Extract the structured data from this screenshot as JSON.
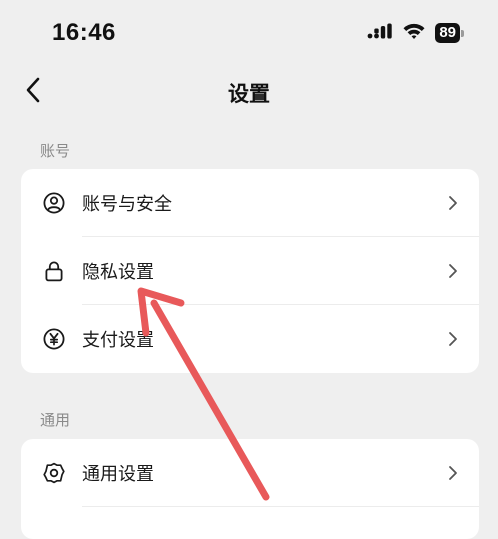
{
  "status_bar": {
    "time": "16:46",
    "battery_level": "89",
    "icons": [
      "cellular-signal-icon",
      "wifi-icon",
      "battery-icon"
    ]
  },
  "nav": {
    "title": "设置",
    "back_icon": "chevron-left-icon"
  },
  "sections": [
    {
      "header": "账号",
      "items": [
        {
          "label": "账号与安全",
          "icon": "user-circle-icon"
        },
        {
          "label": "隐私设置",
          "icon": "lock-icon"
        },
        {
          "label": "支付设置",
          "icon": "yuan-circle-icon"
        }
      ]
    },
    {
      "header": "通用",
      "items": [
        {
          "label": "通用设置",
          "icon": "gear-icon"
        }
      ]
    }
  ],
  "annotation": {
    "color": "#e8595a",
    "icon": "red-arrow-annotation",
    "points_to": "隐私设置"
  },
  "colors": {
    "background": "#efefef",
    "card": "#ffffff",
    "section_header": "#8a8a8a"
  }
}
